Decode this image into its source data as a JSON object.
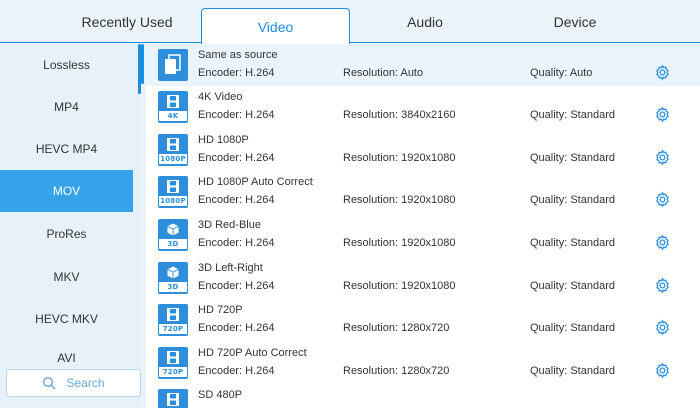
{
  "tabs": [
    {
      "label": "Recently Used"
    },
    {
      "label": "Video"
    },
    {
      "label": "Audio"
    },
    {
      "label": "Device"
    }
  ],
  "sidebar": {
    "items": [
      {
        "label": "Lossless"
      },
      {
        "label": "MP4"
      },
      {
        "label": "HEVC MP4"
      },
      {
        "label": "MOV"
      },
      {
        "label": "ProRes"
      },
      {
        "label": "MKV"
      },
      {
        "label": "HEVC MKV"
      },
      {
        "label": "AVI"
      }
    ],
    "selected": "MOV",
    "search_label": "Search"
  },
  "presets": [
    {
      "name": "Same as source",
      "encoder": "Encoder: H.264",
      "resolution": "Resolution: Auto",
      "quality": "Quality: Auto",
      "icon": "copy-icon"
    },
    {
      "name": "4K Video",
      "encoder": "Encoder: H.264",
      "resolution": "Resolution: 3840x2160",
      "quality": "Quality: Standard",
      "icon": "film-icon",
      "badge": "4K"
    },
    {
      "name": "HD 1080P",
      "encoder": "Encoder: H.264",
      "resolution": "Resolution: 1920x1080",
      "quality": "Quality: Standard",
      "icon": "film-icon",
      "badge": "1080P"
    },
    {
      "name": "HD 1080P Auto Correct",
      "encoder": "Encoder: H.264",
      "resolution": "Resolution: 1920x1080",
      "quality": "Quality: Standard",
      "icon": "film-icon",
      "badge": "1080P"
    },
    {
      "name": "3D Red-Blue",
      "encoder": "Encoder: H.264",
      "resolution": "Resolution: 1920x1080",
      "quality": "Quality: Standard",
      "icon": "cube-icon",
      "badge": "3D"
    },
    {
      "name": "3D Left-Right",
      "encoder": "Encoder: H.264",
      "resolution": "Resolution: 1920x1080",
      "quality": "Quality: Standard",
      "icon": "cube-icon",
      "badge": "3D"
    },
    {
      "name": "HD 720P",
      "encoder": "Encoder: H.264",
      "resolution": "Resolution: 1280x720",
      "quality": "Quality: Standard",
      "icon": "film-icon",
      "badge": "720P"
    },
    {
      "name": "HD 720P Auto Correct",
      "encoder": "Encoder: H.264",
      "resolution": "Resolution: 1280x720",
      "quality": "Quality: Standard",
      "icon": "film-icon",
      "badge": "720P"
    },
    {
      "name": "SD 480P",
      "encoder": "",
      "resolution": "",
      "quality": "",
      "icon": "film-icon",
      "badge": ""
    }
  ],
  "colors": {
    "accent": "#1a8de0",
    "selected_sidebar": "#36a2ea",
    "icon_blue": "#2d8fdc",
    "background": "#eaf3fa"
  }
}
